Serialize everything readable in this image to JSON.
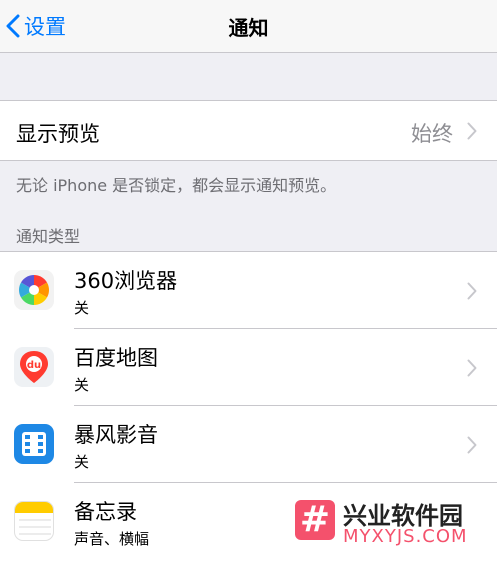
{
  "nav": {
    "back_label": "设置",
    "title": "通知"
  },
  "preview": {
    "label": "显示预览",
    "value": "始终",
    "footer": "无论 iPhone 是否锁定，都会显示通知预览。"
  },
  "section_header": "通知类型",
  "apps": [
    {
      "name": "360浏览器",
      "subtitle": "关",
      "icon": "360-browser-icon"
    },
    {
      "name": "百度地图",
      "subtitle": "关",
      "icon": "baidu-map-icon"
    },
    {
      "name": "暴风影音",
      "subtitle": "关",
      "icon": "baofeng-player-icon"
    },
    {
      "name": "备忘录",
      "subtitle": "声音、横幅",
      "icon": "notes-icon"
    }
  ],
  "watermark": {
    "logo_char": "#",
    "title": "兴业软件园",
    "url": "MYXYJS.COM"
  },
  "colors": {
    "accent": "#007aff",
    "background": "#efeff4",
    "secondary_text": "#8e8e93",
    "watermark": "#f4516c"
  }
}
